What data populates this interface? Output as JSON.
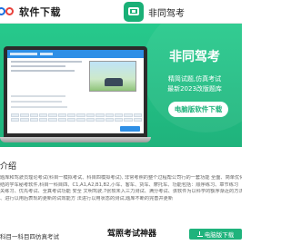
{
  "site": {
    "logo_text": "软件下载"
  },
  "app_header": {
    "title": "非同驾考",
    "icon": "tv-icon"
  },
  "hero": {
    "title": "非同驾考",
    "subtitle_line1": "精简试题,仿真考试",
    "subtitle_line2": "最新2023改版题库",
    "download_label": "电脑版软件下载",
    "bg_color": "#1fb37c"
  },
  "intro": {
    "heading": "介绍",
    "lines": [
      "题库和驾驶员理论考试(科目一模拟考试、科目四模拟考试),  非常考照的整个过程帮公司行的一套功能 全面、简单优化",
      "结的学车秘考软件,科目一科目四、C1,A1,A2,B1,B2,小车、客车、货车、摩托车、功能包括：顺序练习、章节练习",
      "关练习、优先考试、全真考试功能 安全 文明驾驶,7张软未入三力测试、满分考试、该软件为以科学的额序渐近的方法进行各项和",
      "、进行以用后表现的更新的试效能方 法进行以用状态的测试,题库不断的完善并更新"
    ]
  },
  "footer": {
    "left_text": "科目一科目四仿真考试",
    "middle_text": "驾照考试神器",
    "button_label": "电脑版下载"
  }
}
